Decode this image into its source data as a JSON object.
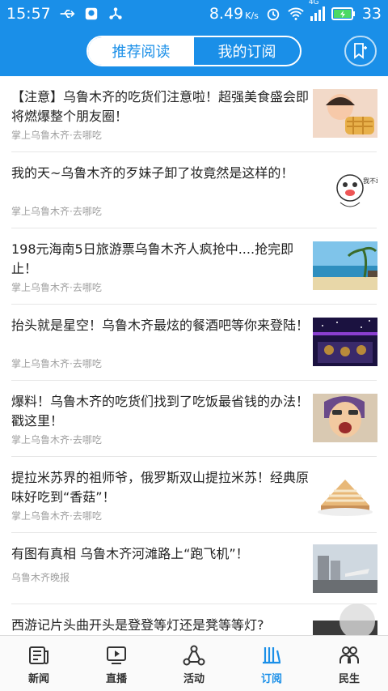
{
  "status": {
    "time": "15:57",
    "speed": "8.49",
    "speed_unit": "K/s",
    "network": "4G",
    "battery": "33"
  },
  "tabs": {
    "recommended": "推荐阅读",
    "subscribed": "我的订阅"
  },
  "articles": [
    {
      "title": "【注意】乌鲁木齐的吃货们注意啦！超强美食盛会即将燃爆整个朋友圈！",
      "source": "掌上乌鲁木齐·去哪吃"
    },
    {
      "title": "我的天~乌鲁木齐的歹妹子卸了妆竟然是这样的！",
      "source": "掌上乌鲁木齐·去哪吃",
      "thumb_text": "我不敢看 脸面太美"
    },
    {
      "title": "198元海南5日旅游票乌鲁木齐人疯抢中....抢完即止！",
      "source": "掌上乌鲁木齐·去哪吃"
    },
    {
      "title": "抬头就是星空！乌鲁木齐最炫的餐酒吧等你来登陆！",
      "source": "掌上乌鲁木齐·去哪吃"
    },
    {
      "title": "爆料！乌鲁木齐的吃货们找到了吃饭最省钱的办法！戳这里！",
      "source": "掌上乌鲁木齐·去哪吃"
    },
    {
      "title": "提拉米苏界的祖师爷，俄罗斯双山提拉米苏！经典原味好吃到“香菇”！",
      "source": "掌上乌鲁木齐·去哪吃"
    },
    {
      "title": "有图有真相 乌鲁木齐河滩路上“跑飞机”！",
      "source": "乌鲁木齐晚报"
    },
    {
      "title": "西游记片头曲开头是登登等灯还是凳等等灯?",
      "source": ""
    }
  ],
  "nav": [
    {
      "label": "新闻",
      "icon": "newspaper-icon"
    },
    {
      "label": "直播",
      "icon": "play-icon"
    },
    {
      "label": "活动",
      "icon": "share-nodes-icon"
    },
    {
      "label": "订阅",
      "icon": "subscribe-icon"
    },
    {
      "label": "民生",
      "icon": "people-icon"
    }
  ],
  "colors": {
    "brand": "#1a8fe8"
  }
}
